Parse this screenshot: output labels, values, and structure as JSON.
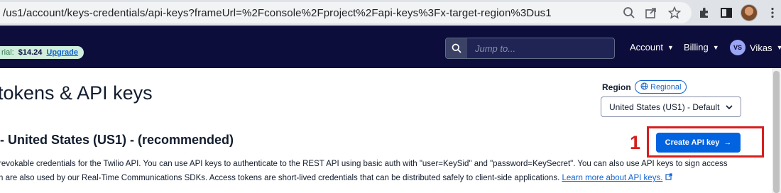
{
  "browser": {
    "url": "/us1/account/keys-credentials/api-keys?frameUrl=%2Fconsole%2Fproject%2Fapi-keys%3Fx-target-region%3Dus1",
    "icons": [
      "zoom-icon",
      "share-icon",
      "star-icon",
      "extensions-icon",
      "sidebar-icon",
      "profile-avatar",
      "menu-icon"
    ]
  },
  "header": {
    "trial_prefix": "rial:",
    "trial_amount": "$14.24",
    "upgrade_label": "Upgrade",
    "search_placeholder": "Jump to...",
    "account_label": "Account",
    "billing_label": "Billing",
    "user_initials": "VS",
    "user_name": "Vikas"
  },
  "main": {
    "page_title": "tokens & API keys",
    "region_label": "Region",
    "regional_badge": "Regional",
    "region_selected": "United States (US1) - Default",
    "section_title": "- United States (US1) - (recommended)",
    "step_number": "1",
    "create_button_label": "Create API key",
    "description_line1": "revokable credentials for the Twilio API. You can use API keys to authenticate to the REST API using basic auth with \"user=KeySid\" and \"password=KeySecret\". You can also use API keys to sign access",
    "description_line2": "n are also used by our Real-Time Communications SDKs. Access tokens are short-lived credentials that can be distributed safely to client-side applications.",
    "learn_more_link": "Learn more about API keys."
  },
  "colors": {
    "nav_bg": "#0d0d3b",
    "primary_button": "#0263e0",
    "highlight_red": "#d61f1f",
    "link_blue": "#1263cc"
  }
}
